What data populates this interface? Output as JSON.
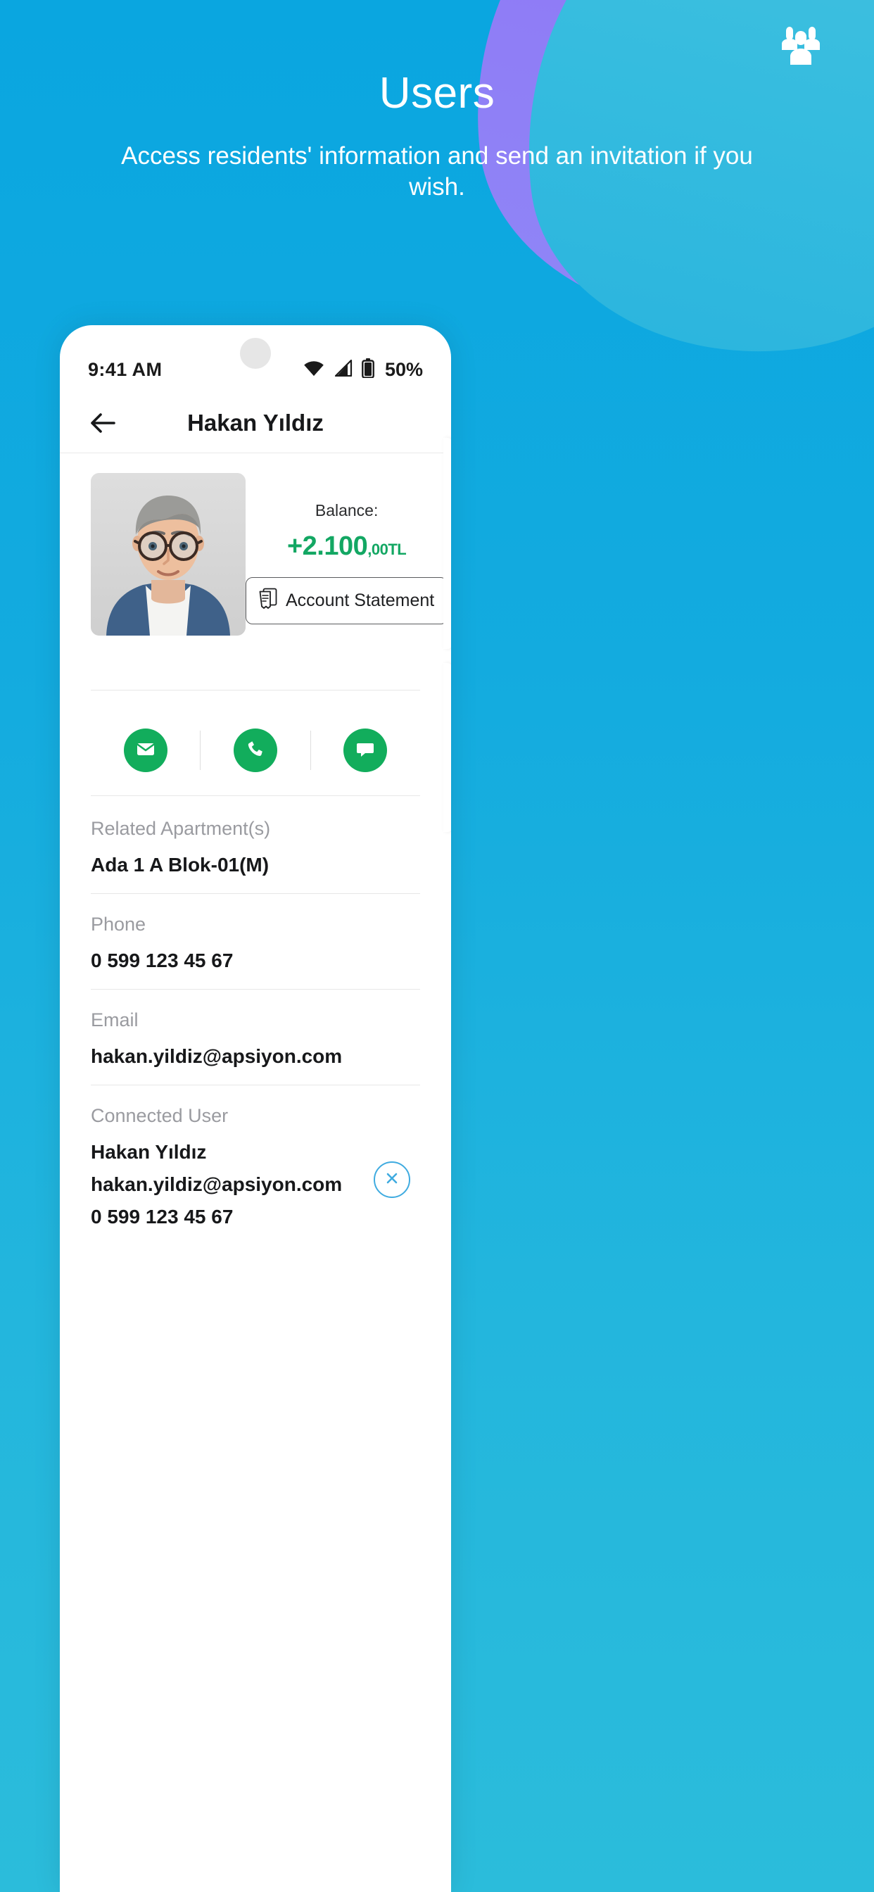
{
  "hero": {
    "title": "Users",
    "subtitle": "Access residents' information and send an invitation if you wish.",
    "icon": "users-people-icon",
    "colors": {
      "background_start": "#0aa6e0",
      "background_end": "#2bbcdb",
      "blob_purple": "#9a7af5",
      "blob_teal": "#35bcdf"
    }
  },
  "phone": {
    "statusbar": {
      "time": "9:41  AM",
      "wifi_icon": "wifi-icon",
      "signal_icon": "cellular-signal-icon",
      "battery_icon": "battery-icon",
      "battery_percent": "50%"
    },
    "appbar": {
      "back_icon": "arrow-left-icon",
      "title": "Hakan Yıldız"
    },
    "profile": {
      "avatar_alt": "user-photo",
      "balance_label": "Balance:",
      "balance_amount_main": "+2.100",
      "balance_amount_cents": ",00TL",
      "balance_color": "#13a763",
      "account_statement_label": "Account Statement",
      "account_statement_icon": "document-statement-icon"
    },
    "quick_actions": [
      {
        "name": "email",
        "icon": "envelope-icon",
        "color": "#12ad5c"
      },
      {
        "name": "call",
        "icon": "phone-icon",
        "color": "#12ad5c"
      },
      {
        "name": "message",
        "icon": "chat-bubble-icon",
        "color": "#12ad5c"
      }
    ],
    "fields": [
      {
        "label": "Related Apartment(s)",
        "value": "Ada 1 A Blok-01(M)"
      },
      {
        "label": "Phone",
        "value": "0 599 123 45 67"
      },
      {
        "label": "Email",
        "value": "hakan.yildiz@apsiyon.com"
      }
    ],
    "connected_user": {
      "label": "Connected User",
      "name": "Hakan Yıldız",
      "email": "hakan.yildiz@apsiyon.com",
      "phone": "0 599 123 45 67",
      "remove_icon": "close-circle-icon",
      "remove_color": "#3fabe0"
    }
  }
}
